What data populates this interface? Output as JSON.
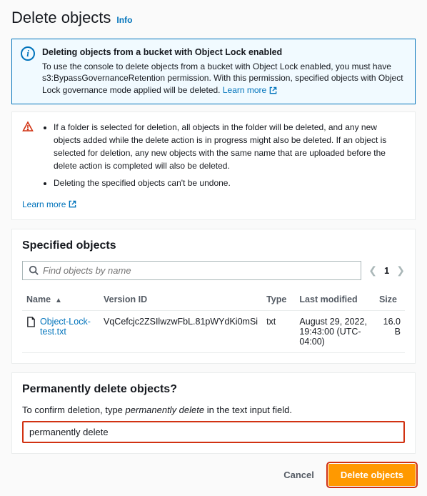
{
  "title": "Delete objects",
  "info_link": "Info",
  "alert": {
    "heading": "Deleting objects from a bucket with Object Lock enabled",
    "body": "To use the console to delete objects from a bucket with Object Lock enabled, you must have s3:BypassGovernanceRetention permission. With this permission, specified objects with Object Lock governance mode applied will be deleted.",
    "learn_more": "Learn more"
  },
  "warning": {
    "items": [
      "If a folder is selected for deletion, all objects in the folder will be deleted, and any new objects added while the delete action is in progress might also be deleted. If an object is selected for deletion, any new objects with the same name that are uploaded before the delete action is completed will also be deleted.",
      "Deleting the specified objects can't be undone."
    ],
    "learn_more": "Learn more"
  },
  "specified": {
    "title": "Specified objects",
    "search_placeholder": "Find objects by name",
    "page": "1",
    "columns": {
      "name": "Name",
      "version": "Version ID",
      "type": "Type",
      "modified": "Last modified",
      "size": "Size"
    },
    "rows": [
      {
        "name": "Object-Lock-test.txt",
        "version": "VqCefcjc2ZSIlwzwFbL.81pWYdKi0mSi",
        "type": "txt",
        "modified": "August 29, 2022, 19:43:00 (UTC-04:00)",
        "size": "16.0 B"
      }
    ]
  },
  "confirm": {
    "title": "Permanently delete objects?",
    "prompt_pre": "To confirm deletion, type ",
    "prompt_phrase": "permanently delete",
    "prompt_post": " in the text input field.",
    "value": "permanently delete"
  },
  "actions": {
    "cancel": "Cancel",
    "delete": "Delete objects"
  }
}
